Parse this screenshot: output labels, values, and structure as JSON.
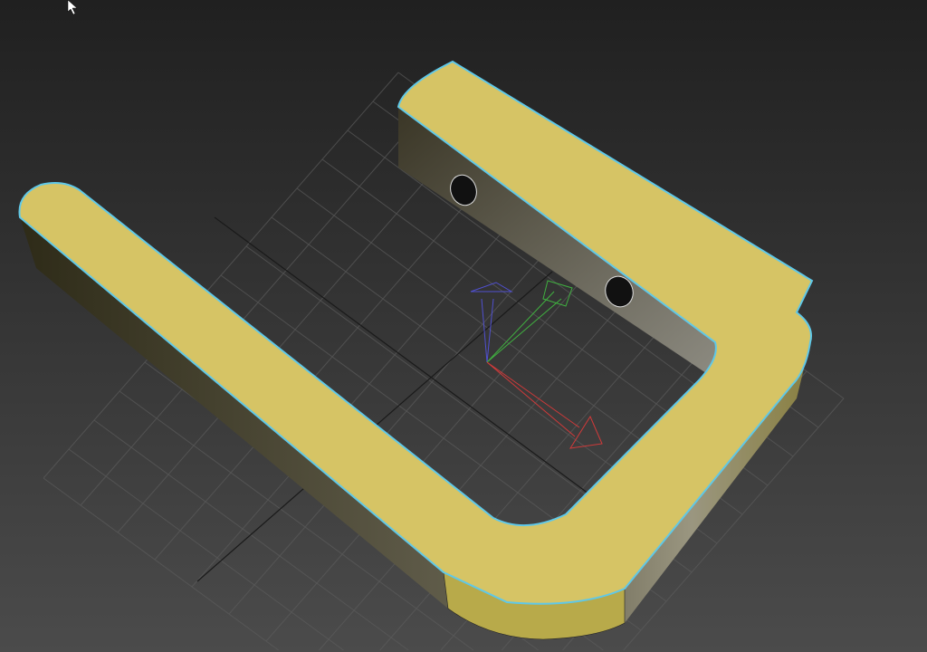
{
  "viewport": {
    "object": "u-bracket",
    "colors": {
      "background_top": "#202020",
      "background_bottom": "#4b4b4b",
      "top_face": "#d6c465",
      "side_face": "#3a3620",
      "selection_outline": "#5fc8e8",
      "grid": "#5a5a5a",
      "axis_x": "#d03a3a",
      "axis_y": "#3ab03a",
      "axis_z": "#4a4ad0"
    }
  }
}
